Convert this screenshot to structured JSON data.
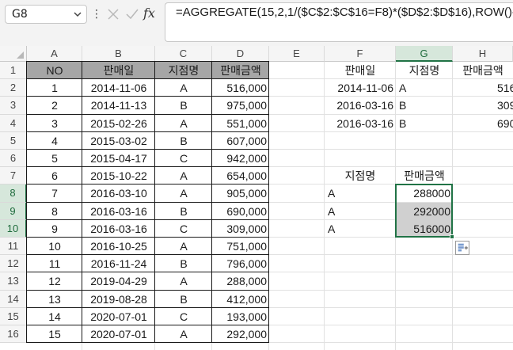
{
  "namebox": {
    "value": "G8"
  },
  "formula": {
    "text": "=AGGREGATE(15,2,1/($C$2:$C$16=F8)*($D$2:$D$16),ROW()-7)"
  },
  "toolbar": {
    "more": "⋮",
    "fx": "fx"
  },
  "columns": [
    "A",
    "B",
    "C",
    "D",
    "E",
    "F",
    "G",
    "H"
  ],
  "rows": [
    "1",
    "2",
    "3",
    "4",
    "5",
    "6",
    "7",
    "8",
    "9",
    "10",
    "11",
    "12",
    "13",
    "14",
    "15",
    "16"
  ],
  "main_table": {
    "headers": [
      "NO",
      "판매일",
      "지점명",
      "판매금액"
    ],
    "rows": [
      [
        "1",
        "2014-11-06",
        "A",
        "516,000"
      ],
      [
        "2",
        "2014-11-13",
        "B",
        "975,000"
      ],
      [
        "3",
        "2015-02-26",
        "A",
        "551,000"
      ],
      [
        "4",
        "2015-03-02",
        "B",
        "607,000"
      ],
      [
        "5",
        "2015-04-17",
        "C",
        "942,000"
      ],
      [
        "6",
        "2015-10-22",
        "A",
        "654,000"
      ],
      [
        "7",
        "2016-03-10",
        "A",
        "905,000"
      ],
      [
        "8",
        "2016-03-16",
        "B",
        "690,000"
      ],
      [
        "9",
        "2016-03-16",
        "C",
        "309,000"
      ],
      [
        "10",
        "2016-10-25",
        "A",
        "751,000"
      ],
      [
        "11",
        "2016-11-24",
        "B",
        "796,000"
      ],
      [
        "12",
        "2019-04-29",
        "A",
        "288,000"
      ],
      [
        "13",
        "2019-08-28",
        "B",
        "412,000"
      ],
      [
        "14",
        "2020-07-01",
        "C",
        "193,000"
      ],
      [
        "15",
        "2020-07-01",
        "A",
        "292,000"
      ]
    ]
  },
  "side_table": {
    "headers": [
      "판매일",
      "지점명",
      "판매금액"
    ],
    "rows": [
      [
        "2014-11-06",
        "A",
        "516"
      ],
      [
        "2016-03-16",
        "B",
        "309"
      ],
      [
        "2016-03-16",
        "B",
        "690"
      ]
    ]
  },
  "lookup_table": {
    "headers": [
      "지점명",
      "판매금액"
    ],
    "rows": [
      [
        "A",
        "288000"
      ],
      [
        "A",
        "292000"
      ],
      [
        "A",
        "516000"
      ]
    ]
  },
  "colors": {
    "accent": "#217346",
    "header_fill": "#a6a6a6",
    "selection_fill": "#d0d0d0"
  }
}
